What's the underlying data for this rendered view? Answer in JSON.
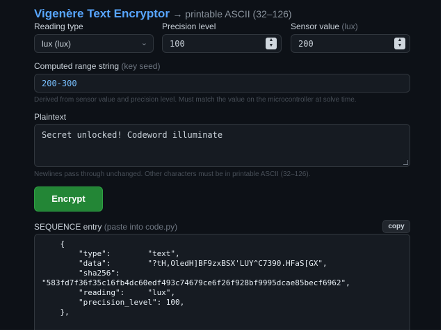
{
  "header": {
    "title": "Vigenère Text Encryptor",
    "subtitle": "→ printable ASCII (32–126)"
  },
  "reading_type": {
    "label": "Reading type",
    "value": "lux (lux)"
  },
  "precision": {
    "label": "Precision level",
    "value": "100"
  },
  "sensor": {
    "label": "Sensor value",
    "unit": "(lux)",
    "value": "200"
  },
  "range": {
    "label": "Computed range string",
    "hint": "(key seed)",
    "value": "200-300",
    "help": "Derived from sensor value and precision level. Must match the value on the microcontroller at solve time."
  },
  "plaintext": {
    "label": "Plaintext",
    "value": "Secret unlocked! Codeword illuminate",
    "help": "Newlines pass through unchanged. Other characters must be in printable ASCII (32–126)."
  },
  "encrypt_button": "Encrypt",
  "sequence": {
    "label": "SEQUENCE entry",
    "hint": "(paste into code.py)",
    "copy_label": "copy",
    "code": "    {\n        \"type\":        \"text\",\n        \"data\":        \"?tH,OledH]BF9zxBSX'LUY^C7390.HFaS[GX\",\n        \"sha256\":\n\"583fd7f36f35c16fb4dc60edf493c74679ce6f26f928bf9995dcae85becf6962\",\n        \"reading\":     \"lux\",\n        \"precision_level\": 100,\n    },"
  },
  "colors": {
    "background": "#0d1117",
    "accent": "#58a6ff",
    "button_green": "#238636"
  },
  "icons": [
    "chevron-down-icon",
    "spinner-arrows-icon",
    "resize-handle-icon"
  ]
}
